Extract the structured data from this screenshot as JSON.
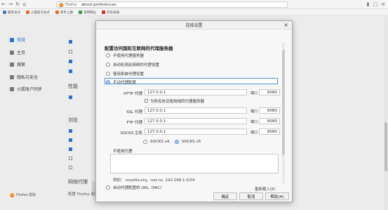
{
  "browser": {
    "tab_label": "Firefox",
    "url": "about:preferences",
    "bookmarks": [
      {
        "label": "最常访问",
        "color": "#4a78c8"
      },
      {
        "label": "火狐官方站点",
        "color": "#e66a2c"
      },
      {
        "label": "新手上路",
        "color": "#e66a2c"
      },
      {
        "label": "常用网址",
        "color": "#3c9a48"
      },
      {
        "label": "京东商城",
        "color": "#d03030"
      }
    ]
  },
  "sidebar": {
    "items": [
      {
        "label": "常规",
        "icon": "gear-icon"
      },
      {
        "label": "主页",
        "icon": "home-icon"
      },
      {
        "label": "搜索",
        "icon": "search-icon"
      },
      {
        "label": "隐私与安全",
        "icon": "lock-icon"
      },
      {
        "label": "火狐账户同步",
        "icon": "sync-icon"
      }
    ],
    "footer": "Firefox 帮助"
  },
  "background": {
    "perf_heading": "性能",
    "browse_heading": "浏览",
    "proxy_heading": "网络代理",
    "proxy_desc": "配置 Firefox 如何连接至互联网"
  },
  "dialog": {
    "title": "连接设置",
    "section_heading": "配置访问国际互联网的代理服务器",
    "options": {
      "no_proxy": "不使用代理服务器",
      "auto_detect": "自动检测此网络的代理设置",
      "system": "使用系统代理设置",
      "manual": "手动代理配置",
      "auto_url": "自动代理配置的 URL（PAC）"
    },
    "http_label": "HTTP 代理",
    "http_value": "127.0.0.1",
    "port_label": "端口",
    "http_port": "8080",
    "share_label": "为所有协议使用相同代理服务器",
    "ssl_label": "SSL 代理",
    "ssl_value": "127.0.0.1",
    "ssl_port": "8080",
    "ftp_label": "FTP 代理",
    "ftp_value": "127.0.0.1",
    "ftp_port": "8080",
    "socks_label": "SOCKS 主机",
    "socks_value": "127.0.0.1",
    "socks_port": "8080",
    "socks_v4": "SOCKS v4",
    "socks_v5": "SOCKS v5",
    "no_proxy_for": "不使用代理",
    "example": "例如：.mozilla.org, .net.nz, 192.168.1.0/24",
    "reload": "重新载入(E)",
    "ok": "确定",
    "cancel": "取消",
    "help": "帮助(H)"
  }
}
